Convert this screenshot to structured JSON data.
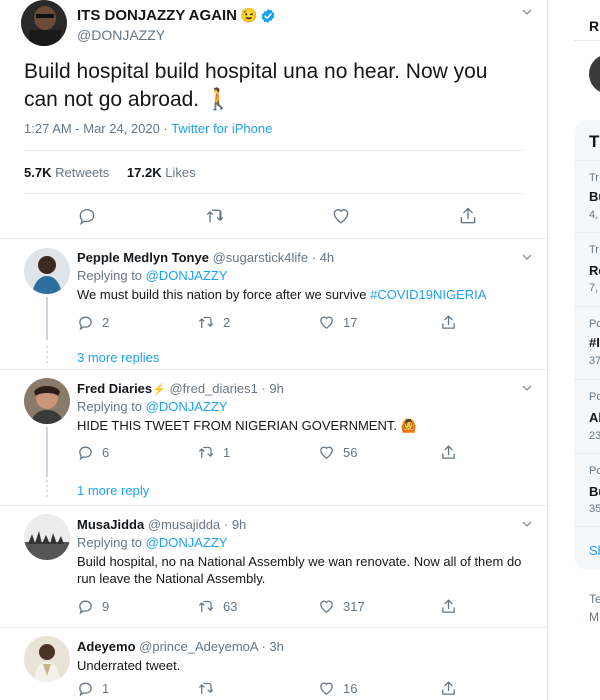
{
  "main_tweet": {
    "display_name": "ITS DONJAZZY AGAIN",
    "emoji": "😉",
    "handle": "@DONJAZZY",
    "text": "Build hospital build hospital una no hear. Now you can not go abroad. 🚶",
    "time": "1:27 AM - Mar 24, 2020",
    "separator": " · ",
    "source": "Twitter for iPhone",
    "retweets_count": "5.7K",
    "retweets_label": "Retweets",
    "likes_count": "17.2K",
    "likes_label": "Likes"
  },
  "replies": [
    {
      "name": "Pepple Medlyn Tonye",
      "handle": "@sugarstick4life · 4h",
      "replying_label": "Replying to",
      "replying_to": "@DONJAZZY",
      "text": "We must build this nation by force after we survive",
      "hashtag": "#COVID19NIGERIA",
      "reply_count": "2",
      "retweet_count": "2",
      "like_count": "17",
      "more_replies": "3 more replies"
    },
    {
      "name": "Fred Diaries",
      "name_suffix": "⚡",
      "handle": "@fred_diaries1 · 9h",
      "replying_label": "Replying to",
      "replying_to": "@DONJAZZY",
      "text": "HIDE THIS TWEET FROM NIGERIAN GOVERNMENT. 🙆",
      "reply_count": "6",
      "retweet_count": "1",
      "like_count": "56",
      "more_replies": "1 more reply"
    },
    {
      "name": "MusaJidda",
      "handle": "@musajidda · 9h",
      "replying_label": "Replying to",
      "replying_to": "@DONJAZZY",
      "text": "Build hospital, no na National Assembly we wan renovate. Now all of them do run leave the National Assembly.",
      "reply_count": "9",
      "retweet_count": "63",
      "like_count": "317"
    },
    {
      "name": "Adeyemo",
      "handle": "@prince_AdeyemoA · 3h",
      "text": "Underrated tweet.",
      "reply_count": "1",
      "retweet_count": "",
      "like_count": "16"
    }
  ],
  "right_column": {
    "header_letter": "R",
    "box_title": "T",
    "trends": [
      {
        "top": "Tr",
        "bottom": "Bu",
        "count": "4,"
      },
      {
        "top": "Tr",
        "bottom": "Re",
        "count": "7,"
      },
      {
        "top": "Po",
        "bottom": "#I",
        "count": "37"
      },
      {
        "top": "Po",
        "bottom": "Al",
        "count": "23"
      },
      {
        "top": "Po",
        "bottom": "Bu",
        "count": "35"
      }
    ],
    "show_more": "Sh",
    "footer_1": "Te",
    "footer_2": "M"
  },
  "colors": {
    "accent": "#1da1f2",
    "secondary_text": "#657786",
    "border": "#e6ecf0",
    "verified": "#1da1f2"
  },
  "icons": [
    "reply-icon",
    "retweet-icon",
    "like-icon",
    "share-icon",
    "verified-badge-icon",
    "chevron-down-icon"
  ]
}
